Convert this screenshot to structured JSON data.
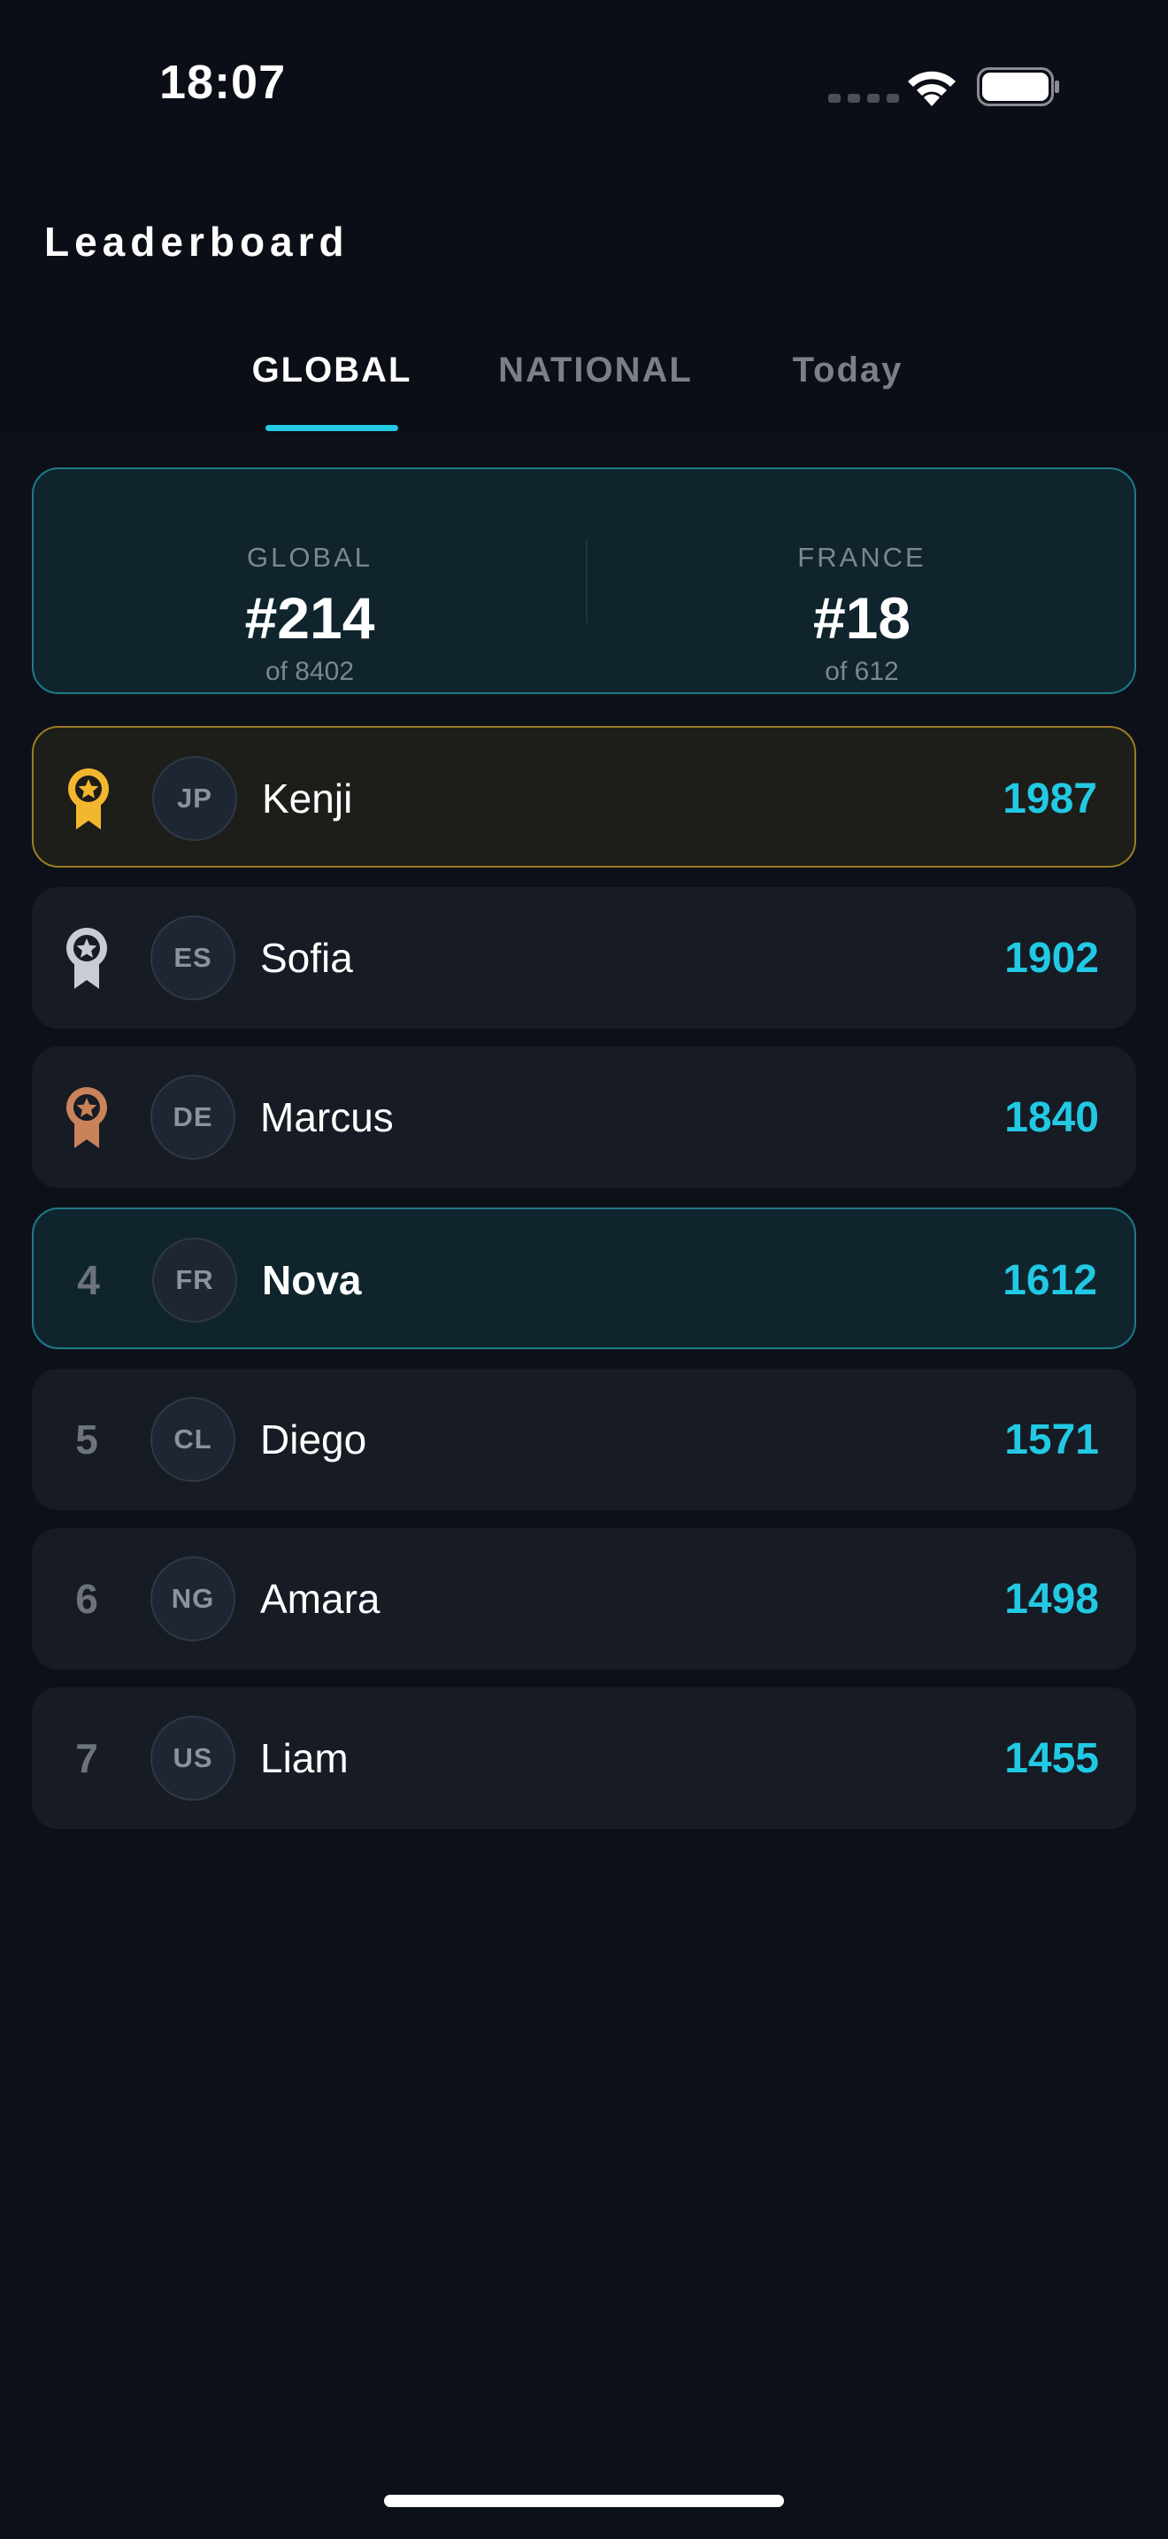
{
  "status_bar": {
    "time": "18:07"
  },
  "header": {
    "title": "Leaderboard",
    "tabs": [
      {
        "label": "GLOBAL",
        "active": true
      },
      {
        "label": "NATIONAL",
        "active": false
      },
      {
        "label": "Today",
        "active": false
      }
    ]
  },
  "summary": {
    "global": {
      "label": "GLOBAL",
      "rank": "#214",
      "total": "of 8402"
    },
    "national": {
      "label": "FRANCE",
      "rank": "#18",
      "total": "of 612"
    }
  },
  "leaderboard": [
    {
      "rank": "1",
      "medal": "gold-medal-icon",
      "country": "JP",
      "name": "Kenji",
      "score": "1987"
    },
    {
      "rank": "2",
      "medal": "silver-medal-icon",
      "country": "ES",
      "name": "Sofia",
      "score": "1902"
    },
    {
      "rank": "3",
      "medal": "bronze-medal-icon",
      "country": "DE",
      "name": "Marcus",
      "score": "1840"
    },
    {
      "rank": "4",
      "country": "FR",
      "name": "Nova",
      "score": "1612",
      "is_current_user": true
    },
    {
      "rank": "5",
      "country": "CL",
      "name": "Diego",
      "score": "1571"
    },
    {
      "rank": "6",
      "country": "NG",
      "name": "Amara",
      "score": "1498"
    },
    {
      "rank": "7",
      "country": "US",
      "name": "Liam",
      "score": "1455"
    }
  ],
  "colors": {
    "accent": "#22c9e4",
    "gold": "#f3b72f",
    "silver": "#c9ccd2",
    "bronze": "#c9825a",
    "background": "#0b0e16",
    "card": "#161b24"
  }
}
